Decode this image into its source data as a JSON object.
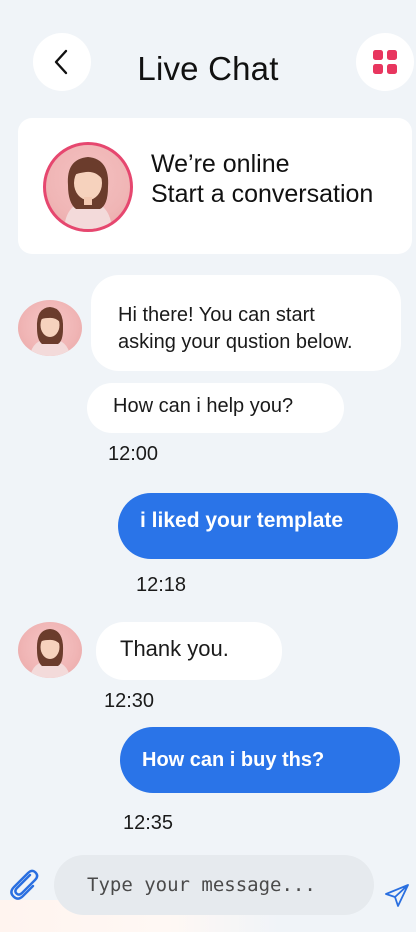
{
  "header": {
    "title": "Live Chat",
    "back_icon": "chevron-left-icon",
    "menu_icon": "grid-icon",
    "accent": "#e8365f"
  },
  "status_card": {
    "line1": "We’re online",
    "line2": "Start a conversation"
  },
  "messages": [
    {
      "from": "agent",
      "text": "Hi there! You can start asking your qustion below."
    },
    {
      "from": "agent",
      "text": "How can i help you?",
      "time": "12:00"
    },
    {
      "from": "user",
      "text": "i liked your template",
      "time": "12:18"
    },
    {
      "from": "agent",
      "text": "Thank you.",
      "time": "12:30"
    },
    {
      "from": "user",
      "text": "How can i buy ths?",
      "time": "12:35"
    }
  ],
  "message_lines": {
    "m0_l1": "Hi there! You can start",
    "m0_l2": "asking your qustion below."
  },
  "composer": {
    "placeholder": "Type your message...",
    "attach_icon": "paperclip-icon",
    "send_icon": "send-icon"
  },
  "colors": {
    "background": "#f0f4f8",
    "user_bubble": "#2a74e8",
    "agent_bubble": "#ffffff"
  }
}
